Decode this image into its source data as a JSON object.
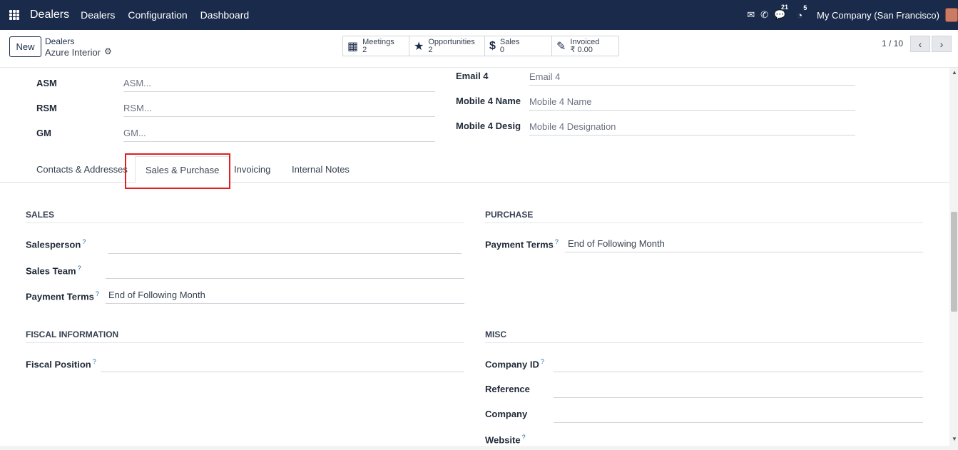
{
  "navbar": {
    "app_title": "Dealers",
    "menu": [
      "Dealers",
      "Configuration",
      "Dashboard"
    ],
    "messages_badge": "21",
    "activities_badge": "5",
    "company": "My Company (San Francisco)"
  },
  "control": {
    "new_label": "New",
    "breadcrumb": "Dealers",
    "record_name": "Azure Interior",
    "smart_buttons": [
      {
        "label": "Meetings",
        "value": "2",
        "icon": "calendar-icon"
      },
      {
        "label": "Opportunities",
        "value": "2",
        "icon": "star-icon"
      },
      {
        "label": "Sales",
        "value": "0",
        "icon": "dollar-icon"
      },
      {
        "label": "Invoiced",
        "value": "₹ 0.00",
        "icon": "edit-icon"
      }
    ],
    "pager": "1 / 10"
  },
  "top_fields_left": [
    {
      "label": "ASM",
      "placeholder": "ASM..."
    },
    {
      "label": "RSM",
      "placeholder": "RSM..."
    },
    {
      "label": "GM",
      "placeholder": "GM..."
    }
  ],
  "top_fields_right": [
    {
      "label": "Email 4",
      "placeholder": "Email 4"
    },
    {
      "label": "Mobile 4 Name",
      "placeholder": "Mobile 4 Name"
    },
    {
      "label": "Mobile 4 Desig",
      "placeholder": "Mobile 4 Designation"
    }
  ],
  "tabs": [
    "Contacts & Addresses",
    "Sales & Purchase",
    "Invoicing",
    "Internal Notes"
  ],
  "sales": {
    "title": "SALES",
    "salesperson_label": "Salesperson",
    "salesperson_value": "",
    "sales_team_label": "Sales Team",
    "sales_team_value": "",
    "payment_terms_label": "Payment Terms",
    "payment_terms_value": "End of Following Month"
  },
  "purchase": {
    "title": "PURCHASE",
    "payment_terms_label": "Payment Terms",
    "payment_terms_value": "End of Following Month"
  },
  "fiscal": {
    "title": "FISCAL INFORMATION",
    "fiscal_position_label": "Fiscal Position",
    "fiscal_position_value": ""
  },
  "misc": {
    "title": "MISC",
    "company_id_label": "Company ID",
    "reference_label": "Reference",
    "company_label": "Company",
    "website_label": "Website"
  },
  "help_mark": "?"
}
